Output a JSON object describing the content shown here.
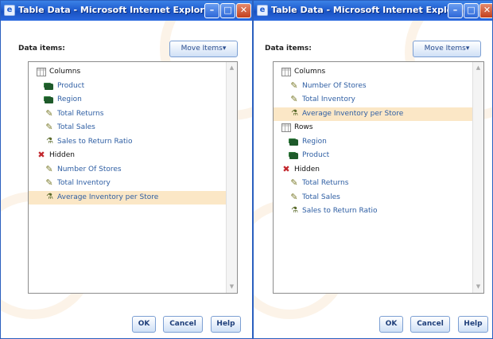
{
  "windows": [
    {
      "title": "Table Data - Microsoft Internet Explorer",
      "title_buttons": {
        "minimize": "–",
        "maximize": "□",
        "close": "✕"
      },
      "data_items_label": "Data items:",
      "move_items_label": "Move Items▾",
      "tree": [
        {
          "text": "Columns",
          "kind": "group",
          "icon": "table-grid-icon",
          "selected": false
        },
        {
          "text": "Product",
          "kind": "item",
          "icon": "category-icon",
          "selected": false
        },
        {
          "text": "Region",
          "kind": "item",
          "icon": "category-icon",
          "selected": false
        },
        {
          "text": "Total Returns",
          "kind": "item",
          "icon": "measure-icon",
          "selected": false
        },
        {
          "text": "Total Sales",
          "kind": "item",
          "icon": "measure-icon",
          "selected": false
        },
        {
          "text": "Sales to Return Ratio",
          "kind": "item",
          "icon": "calculated-measure-icon",
          "selected": false
        },
        {
          "text": "Hidden",
          "kind": "group",
          "icon": "hidden-icon",
          "selected": false
        },
        {
          "text": "Number Of Stores",
          "kind": "item",
          "icon": "measure-icon",
          "selected": false
        },
        {
          "text": "Total Inventory",
          "kind": "item",
          "icon": "measure-icon",
          "selected": false
        },
        {
          "text": "Average Inventory per Store",
          "kind": "item",
          "icon": "calculated-measure-icon",
          "selected": true
        }
      ],
      "buttons": {
        "ok": "OK",
        "cancel": "Cancel",
        "help": "Help"
      }
    },
    {
      "title": "Table Data - Microsoft Internet Explorer",
      "title_buttons": {
        "minimize": "–",
        "maximize": "□",
        "close": "✕"
      },
      "data_items_label": "Data items:",
      "move_items_label": "Move Items▾",
      "tree": [
        {
          "text": "Columns",
          "kind": "group",
          "icon": "table-grid-icon",
          "selected": false
        },
        {
          "text": "Number Of Stores",
          "kind": "item",
          "icon": "measure-icon",
          "selected": false
        },
        {
          "text": "Total Inventory",
          "kind": "item",
          "icon": "measure-icon",
          "selected": false
        },
        {
          "text": "Average Inventory per Store",
          "kind": "item",
          "icon": "calculated-measure-icon",
          "selected": true
        },
        {
          "text": "Rows",
          "kind": "group",
          "icon": "table-grid-icon",
          "selected": false
        },
        {
          "text": "Region",
          "kind": "item",
          "icon": "category-icon",
          "selected": false
        },
        {
          "text": "Product",
          "kind": "item",
          "icon": "category-icon",
          "selected": false
        },
        {
          "text": "Hidden",
          "kind": "group",
          "icon": "hidden-icon",
          "selected": false
        },
        {
          "text": "Total Returns",
          "kind": "item",
          "icon": "measure-icon",
          "selected": false
        },
        {
          "text": "Total Sales",
          "kind": "item",
          "icon": "measure-icon",
          "selected": false
        },
        {
          "text": "Sales to Return Ratio",
          "kind": "item",
          "icon": "calculated-measure-icon",
          "selected": false
        }
      ],
      "buttons": {
        "ok": "OK",
        "cancel": "Cancel",
        "help": "Help"
      }
    }
  ],
  "colors": {
    "titlebar": "#1f5ccf",
    "item_text": "#2e5ea3",
    "selected_row": "#fbe7c6",
    "hidden_icon": "#c2272d"
  }
}
